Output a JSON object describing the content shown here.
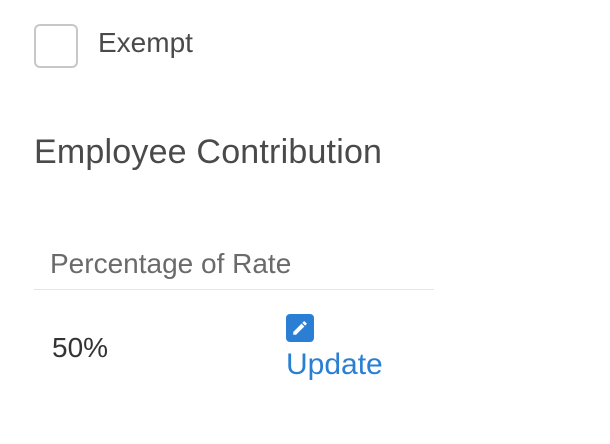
{
  "exempt": {
    "label": "Exempt",
    "checked": false
  },
  "section": {
    "title": "Employee Contribution"
  },
  "table": {
    "columns": [
      "Percentage of Rate"
    ],
    "rows": [
      {
        "percentage": "50%",
        "action": {
          "label": "Update",
          "icon": "edit-icon"
        }
      }
    ]
  },
  "colors": {
    "accent": "#2a7fd4",
    "text": "#4a4a4a",
    "checkbox_border": "#c7c7c7"
  }
}
